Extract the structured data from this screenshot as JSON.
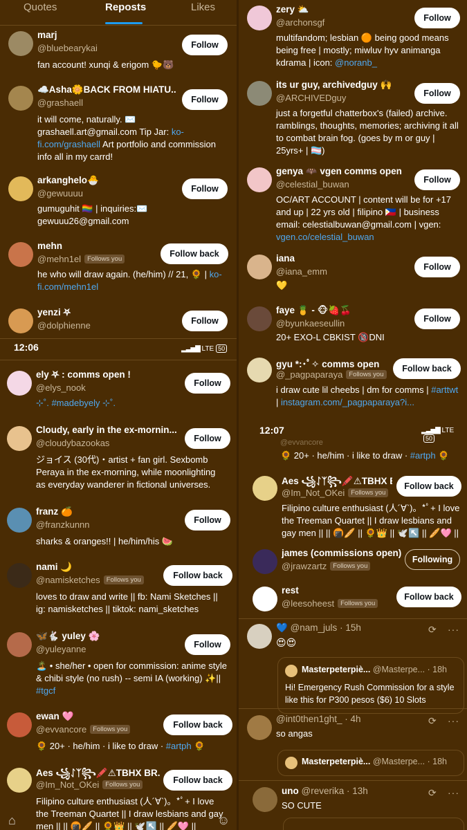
{
  "colors": {
    "background": "#4a2c04",
    "accent_link": "#4fa8f0",
    "tab_indicator": "#1d9bf0",
    "button_bg": "#ffffff"
  },
  "tabs": [
    "Quotes",
    "Reposts",
    "Likes"
  ],
  "status_bar": {
    "time1": "12:06",
    "time2": "12:07",
    "network": "LTE",
    "battery": "50"
  },
  "labels": {
    "follow": "Follow",
    "follow_back": "Follow back",
    "following": "Following",
    "follows_you": "Follows you"
  },
  "panel1": [
    {
      "name": "marj",
      "handle": "@bluebearykai",
      "bio": "fan account! xunqi & erigom 🐤🐻"
    },
    {
      "name": "☁️Asha🌼BACK FROM HIATU...",
      "handle": "@grashaell",
      "bio": "it will come, naturally. ✉️ grashaell.art@gmail.com Tip Jar: ",
      "bio_link": "ko-fi.com/grashaell",
      "bio_after": " Art portfolio and commission info all in my carrd!"
    },
    {
      "name": "arkanghelo🐣",
      "handle": "@gewuuuu",
      "bio": "gumuguhit 🏳️‍🌈 | inquiries:✉️ gewuuu26@gmail.com"
    },
    {
      "name": "mehn",
      "handle": "@mehn1el",
      "bio": "he who will draw again. (he/him) // 21, 🌻 | ",
      "bio_link": "ko-fi.com/mehn1el"
    },
    {
      "name": "yenzi ⛧",
      "handle": "@dolphienne"
    }
  ],
  "panel2": [
    {
      "name": "ely ⛧ : comms open !",
      "handle": "@elys_nook",
      "bio_link": "⊹˚. #madebyely ⊹˚."
    },
    {
      "name": "Cloudy, early in the ex-mornin...",
      "handle": "@cloudybazookas",
      "bio": "ジョイス (30代)・artist + fan girl. Sexbomb Peraya in the ex-morning, while moonlighting as everyday wanderer in fictional universes."
    },
    {
      "name": "franz 🍊",
      "handle": "@franzkunnn",
      "bio": "sharks & oranges!! | he/him/his 🍉"
    },
    {
      "name": "nami 🌙",
      "handle": "@namisketches",
      "bio": "loves to draw and write || fb: Nami Sketches || ig: namisketches || tiktok: nami_sketches"
    },
    {
      "name": "🦋🐇 yuley 🌸",
      "handle": "@yuleyanne",
      "bio": "🏝️ • she/her • open for commission: anime style & chibi style (no rush) -- semi IA (working) ✨|| ",
      "bio_link": "#tgcf"
    },
    {
      "name": "ewan 🩷",
      "handle": "@evvancore",
      "bio": "🌻 20+ · he/him · i like to draw · ",
      "bio_link": "#artph",
      "bio_after": " 🌻"
    },
    {
      "name": "Aes ꧁ᛇᛉ꧂🖍️⚠TBHX BR...",
      "handle": "@Im_Not_OKei",
      "bio": "Filipino culture enthusiast (人´∀`)。*ﾟ+ I love the Treeman Quartet || I draw lesbians and gay men || || 🍘🥖 || 🌻👑 || 🕊️↖️ || 🥖🩷 ||"
    }
  ],
  "panel3": [
    {
      "name": "zery ⛅",
      "handle": "@archonsgf",
      "bio": "multifandom; lesbian 🟠 being good means being free | mostly; miwluv hyv animanga kdrama | icon: ",
      "bio_link": "@noranb_"
    },
    {
      "name": "its ur guy, archivedguy 🙌",
      "handle": "@ARCHIVEDguy",
      "bio": "just a forgetful chatterbox's (failed) archive. ramblings, thoughts, memories; archiving it all to combat brain fog. (goes by m or guy | 25yrs+ | 🏳️‍⚧️)"
    },
    {
      "name": "genya 🦇 vgen comms open",
      "handle": "@celestial_buwan",
      "bio": "OC/ART ACCOUNT | content will be for +17 and up | 22 yrs old | filipino 🇵🇭 | business email: celestialbuwan@gmail.com | vgen: ",
      "bio_link": "vgen.co/celestial_buwan"
    },
    {
      "name": "iana",
      "handle": "@iana_emm",
      "bio": "💛"
    },
    {
      "name": "faye 🍍 - 🐵🍓🍒",
      "handle": "@byunkaeseullin",
      "bio": "20+ EXO-L CBKIST 🔞DNI"
    },
    {
      "name": "gyu *:･ﾟ✧ comms open",
      "handle": "@_pagpaparaya",
      "bio": "i draw cute lil cheebs | dm for comms | ",
      "bio_link": "#arttwt",
      "bio_after": " | ",
      "bio_link2": "instagram.com/_pagpaparaya?i..."
    }
  ],
  "panel4": {
    "partial_handle": "@evvancore",
    "partial_bio": "🌻 20+ · he/him · i like to draw · ",
    "partial_link": "#artph",
    "partial_after": " 🌻",
    "users": [
      {
        "name": "Aes ꧁ᛇᛉ꧂🖍️⚠TBHX BR...",
        "handle": "@Im_Not_OKei",
        "bio": "Filipino culture enthusiast (人´∀`)。*ﾟ+ I love the Treeman Quartet || I draw lesbians and gay men || || 🍘🥖 || 🌻👑 || 🕊️↖️ || 🥖🩷 ||"
      },
      {
        "name": "james (commissions open)",
        "handle": "@jrawzartz"
      },
      {
        "name": "rest",
        "handle": "@leesoheest"
      }
    ]
  },
  "panel5": {
    "posts": [
      {
        "handle": "@nam_juls",
        "time": "15h",
        "text": "😍😍",
        "quote_name": "Masterpeterpiè...",
        "quote_handle": "@Masterpe...",
        "quote_time": "18h",
        "quote_text": "Hi! Emergency Rush Commission for a style like this for P300 pesos ($6) 10 Slots"
      },
      {
        "handle": "@int0then1ght_",
        "time": "4h",
        "text": "so angas",
        "quote_name": "Masterpeterpiè...",
        "quote_handle": "@Masterpe...",
        "quote_time": "18h"
      },
      {
        "name": "uno",
        "handle": "@reverika",
        "time": "13h",
        "text": "SO CUTE"
      }
    ]
  }
}
